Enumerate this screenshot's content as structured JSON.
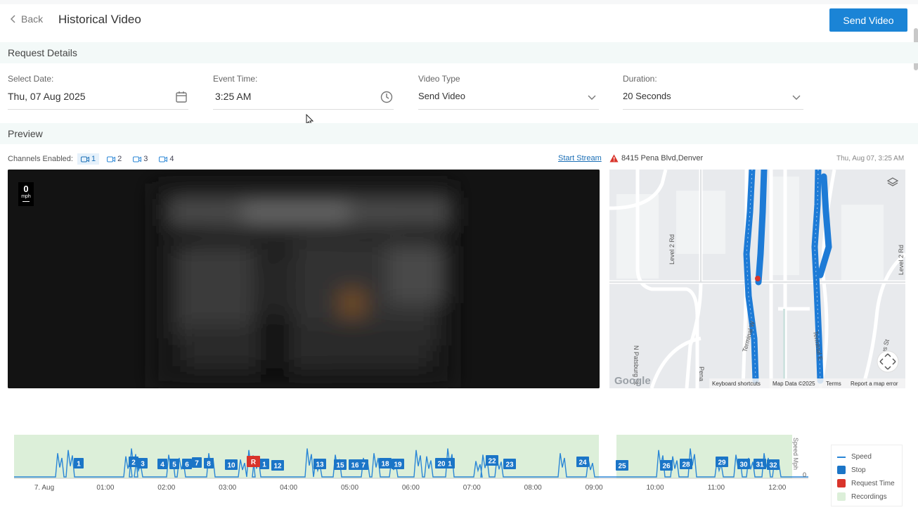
{
  "header": {
    "back_label": "Back",
    "title": "Historical Video",
    "send_label": "Send Video"
  },
  "request": {
    "section_title": "Request Details",
    "fields": [
      {
        "label": "Select Date:",
        "value": "Thu, 07 Aug 2025",
        "icon": "calendar-icon"
      },
      {
        "label": "Event Time:",
        "value": "3:25 AM",
        "icon": "clock-icon"
      },
      {
        "label": "Video Type",
        "value": "Send Video",
        "icon": "chevron-down-icon"
      },
      {
        "label": "Duration:",
        "value": "20 Seconds",
        "icon": "chevron-down-icon"
      }
    ]
  },
  "preview": {
    "section_title": "Preview",
    "channels_label": "Channels Enabled:",
    "channels": [
      "1",
      "2",
      "3",
      "4"
    ],
    "active_channel": "1",
    "start_stream_label": "Start Stream",
    "speed_value": "0",
    "speed_unit": "mph",
    "location": "8415 Pena Blvd,Denver",
    "location_time": "Thu, Aug 07, 3:25 AM"
  },
  "map": {
    "street_labels": [
      "Level 2 Rd",
      "N Patsburg St",
      "Pena",
      "Terminal W",
      "Terminal E",
      "Level 2 Rd",
      "N Titus St"
    ],
    "footer": [
      "Keyboard shortcuts",
      "Map Data ©2025",
      "Terms",
      "Report a map error"
    ],
    "logo": "Google",
    "colors": {
      "base": "#e8eaed",
      "road": "#ffffff",
      "traffic": "#1e7bd6"
    }
  },
  "timeline": {
    "x_ticks": [
      "7. Aug",
      "01:00",
      "02:00",
      "03:00",
      "04:00",
      "05:00",
      "06:00",
      "07:00",
      "08:00",
      "09:00",
      "10:00",
      "11:00",
      "12:00"
    ],
    "y_axis_label": "Speed Mph",
    "y_tick": "0",
    "stop_markers": [
      "1",
      "2",
      "3",
      "4",
      "5",
      "6",
      "7",
      "8",
      "10",
      "1",
      "12",
      "13",
      "15",
      "16",
      "7",
      "18",
      "19",
      "20",
      "1",
      "22",
      "23",
      "24",
      "25",
      "26",
      "28",
      "29",
      "30",
      "31",
      "32"
    ],
    "request_marker": "R",
    "legend": [
      "Speed",
      "Stop",
      "Request Time",
      "Recordings"
    ],
    "colors": {
      "speed": "#2a86d6",
      "stop": "#1b75c7",
      "request": "#d9342b",
      "recordings": "#dcefd9"
    }
  }
}
